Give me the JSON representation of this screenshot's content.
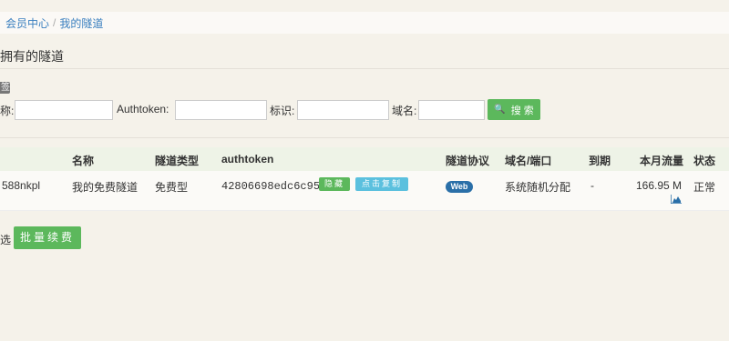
{
  "breadcrumb": {
    "items": [
      "会员中心",
      "我的隧道"
    ],
    "separator": "/"
  },
  "page": {
    "title": "拥有的隧道"
  },
  "search": {
    "badge": "签",
    "name_label": "称:",
    "name_value": "",
    "authtoken_label": "Authtoken:",
    "authtoken_value": "",
    "tag_label": "标识:",
    "tag_value": "",
    "domain_label": "域名:",
    "domain_value": "",
    "button_label": "搜 索",
    "button_icon": "search-icon"
  },
  "table": {
    "headers": {
      "name": "名称",
      "type": "隧道类型",
      "authtoken": "authtoken",
      "protocol": "隧道协议",
      "domain": "域名/端口",
      "expire": "到期",
      "traffic": "本月流量",
      "status": "状态"
    },
    "rows": [
      {
        "id": "588nkpl",
        "name": "我的免费隧道",
        "type": "免费型",
        "authtoken": "42806698edc6c952",
        "hide_label": "隐藏",
        "copy_label": "点击复制",
        "protocol": "Web",
        "domain": "系统随机分配",
        "expire": "-",
        "traffic": "166.95 M",
        "status": "正常"
      }
    ]
  },
  "batch": {
    "select_label": "选",
    "button_label": "批量续费"
  },
  "colors": {
    "accent_green": "#5cb85c",
    "info_blue": "#5bc0de",
    "badge_blue": "#2a6fa8",
    "link": "#3a7fbf"
  }
}
